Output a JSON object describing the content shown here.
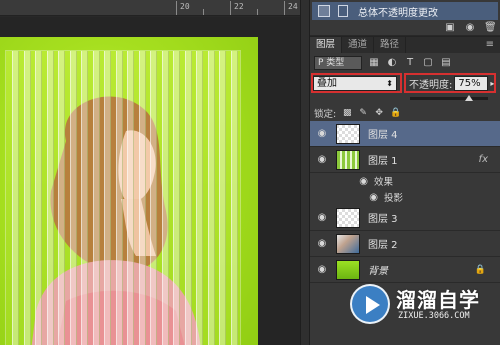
{
  "ruler": {
    "labels": [
      "20",
      "22",
      "24"
    ]
  },
  "history": {
    "item_label": "总体不透明度更改",
    "tools": [
      "new-snapshot-icon",
      "camera-icon",
      "trash-icon"
    ]
  },
  "tabs": [
    "图层",
    "通道",
    "路径"
  ],
  "filter": {
    "label": "P 类型",
    "icons": [
      "image-icon",
      "adjust-icon",
      "text-icon",
      "shape-icon",
      "smart-object-icon"
    ]
  },
  "blend": {
    "mode": "叠加",
    "opacity_label": "不透明度:",
    "opacity_value": "75%",
    "opacity_level": 0.75
  },
  "lock": {
    "label": "锁定:"
  },
  "layers": [
    {
      "name": "图层 4",
      "selected": true,
      "thumb": "transparent"
    },
    {
      "name": "图层 1",
      "selected": false,
      "thumb": "stripes",
      "fx": "fx"
    },
    {
      "name": "效果",
      "type": "effect"
    },
    {
      "name": "投影",
      "type": "effect-sub"
    },
    {
      "name": "图层 3",
      "selected": false,
      "thumb": "transparent"
    },
    {
      "name": "图层 2",
      "selected": false,
      "thumb": "photo"
    },
    {
      "name": "背景",
      "selected": false,
      "thumb": "green",
      "locked": true
    }
  ],
  "watermark": {
    "title": "溜溜自学",
    "subtitle": "ZIXUE.3066.COM"
  }
}
